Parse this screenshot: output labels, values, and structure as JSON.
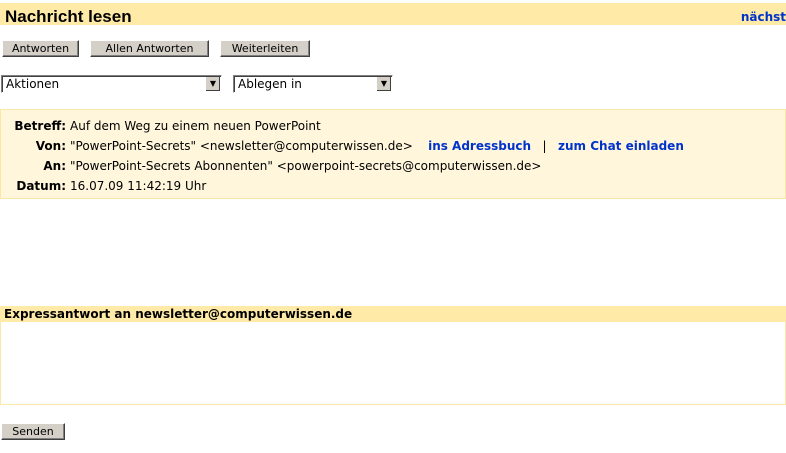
{
  "header": {
    "title": "Nachricht lesen",
    "next_link": "nächst"
  },
  "toolbar": {
    "reply": "Antworten",
    "reply_all": "Allen Antworten",
    "forward": "Weiterleiten"
  },
  "selects": {
    "actions": "Aktionen",
    "file_in": "Ablegen in"
  },
  "message": {
    "subject_label": "Betreff:",
    "subject": "Auf dem Weg zu einem neuen PowerPoint",
    "from_label": "Von:",
    "from": "\"PowerPoint-Secrets\" <newsletter@computerwissen.de>",
    "add_contact": "ins Adressbuch",
    "separator": "|",
    "invite_chat": "zum Chat einladen",
    "to_label": "An:",
    "to": "\"PowerPoint-Secrets Abonnenten\" <powerpoint-secrets@computerwissen.de>",
    "date_label": "Datum:",
    "date": "16.07.09 11:42:19 Uhr"
  },
  "express": {
    "title": "Expressantwort an newsletter@computerwissen.de",
    "value": "",
    "send": "Senden"
  }
}
